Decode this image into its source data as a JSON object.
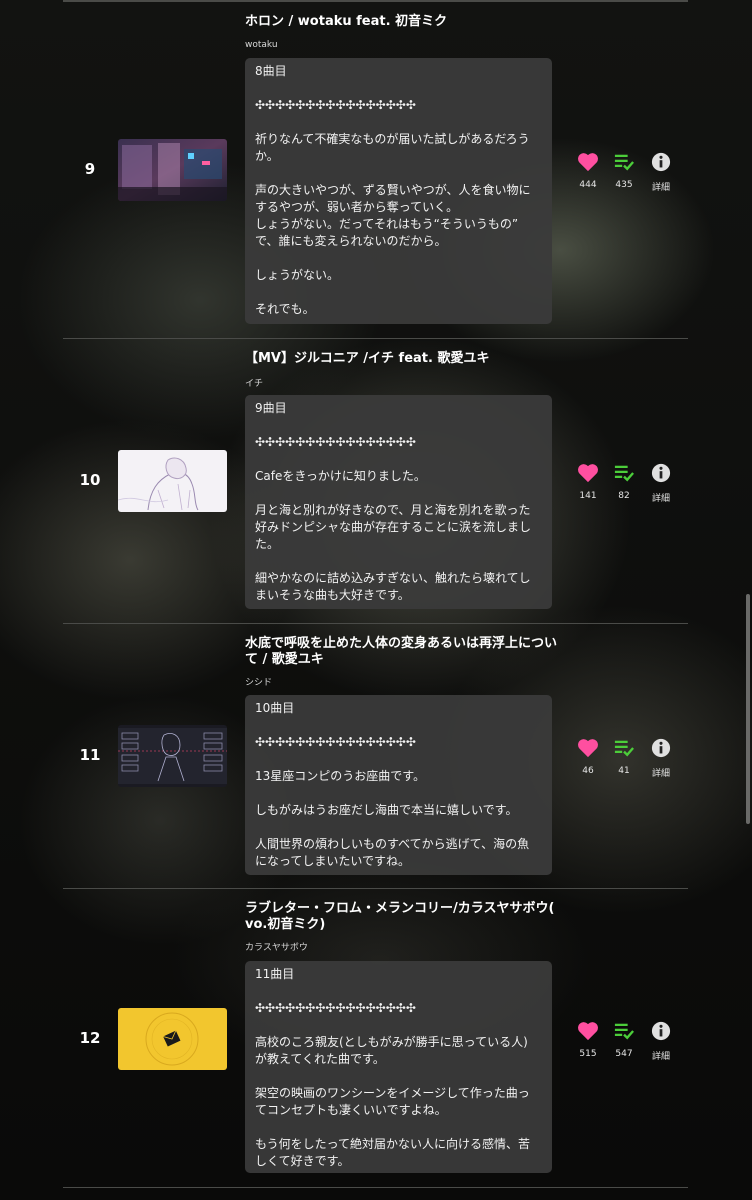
{
  "colors": {
    "heart": "#ff4fa0",
    "mylist": "#4ccd3a",
    "info": "#e0e0e0"
  },
  "entries": [
    {
      "rank": "9",
      "title": "ホロン / wotaku feat. 初音ミク",
      "artist": "wotaku",
      "comment": "8曲目\n\n✣✣✣✣✣✣✣✣✣✣✣✣✣✣✣✣\n\n祈りなんて不確実なものが届いた試しがあるだろう\nか。\n\n声の大きいやつが、ずる賢いやつが、人を食い物に\nするやつが、弱い者から奪っていく。\nしょうがない。だってそれはもう“そういうもの”\nで、誰にも変えられないのだから。\n\nしょうがない。\n\nそれでも。",
      "likes": "444",
      "mylist": "435",
      "info_label": "詳細",
      "thumb_icon": "neon-city-thumbnail"
    },
    {
      "rank": "10",
      "title": "【MV】ジルコニア /イチ feat. 歌愛ユキ",
      "artist": "イチ",
      "comment": "9曲目\n\n✣✣✣✣✣✣✣✣✣✣✣✣✣✣✣✣\n\nCafeをきっかけに知りました。\n\n月と海と別れが好きなので、月と海を別れを歌った\n好みドンピシャな曲が存在することに涙を流しまし\nた。\n\n細やかなのに詰め込みすぎない、触れたら壊れてし\nまいそうな曲も大好きです。",
      "likes": "141",
      "mylist": "82",
      "info_label": "詳細",
      "thumb_icon": "sketch-girl-thumbnail"
    },
    {
      "rank": "11",
      "title": "水底で呼吸を止めた人体の変身あるいは再浮上につい\nて / 歌愛ユキ",
      "artist": "シシド",
      "comment": "10曲目\n\n✣✣✣✣✣✣✣✣✣✣✣✣✣✣✣✣\n\n13星座コンピのうお座曲です。\n\nしもがみはうお座だし海曲で本当に嬉しいです。\n\n人間世界の煩わしいものすべてから逃げて、海の魚\nになってしまいたいですね。",
      "likes": "46",
      "mylist": "41",
      "info_label": "詳細",
      "thumb_icon": "dark-ui-girl-thumbnail"
    },
    {
      "rank": "12",
      "title": "ラブレター・フロム・メランコリー/カラスヤサボウ(\nvo.初音ミク)",
      "artist": "カラスヤサボウ",
      "comment": "11曲目\n\n✣✣✣✣✣✣✣✣✣✣✣✣✣✣✣✣\n\n高校のころ親友(としもがみが勝手に思っている人)\nが教えてくれた曲です。\n\n架空の映画のワンシーンをイメージして作った曲っ\nてコンセプトも凄くいいですよね。\n\nもう何をしたって絶対届かない人に向ける感情、苦\nしくて好きです。",
      "likes": "515",
      "mylist": "547",
      "info_label": "詳細",
      "thumb_icon": "yellow-envelope-thumbnail"
    }
  ]
}
